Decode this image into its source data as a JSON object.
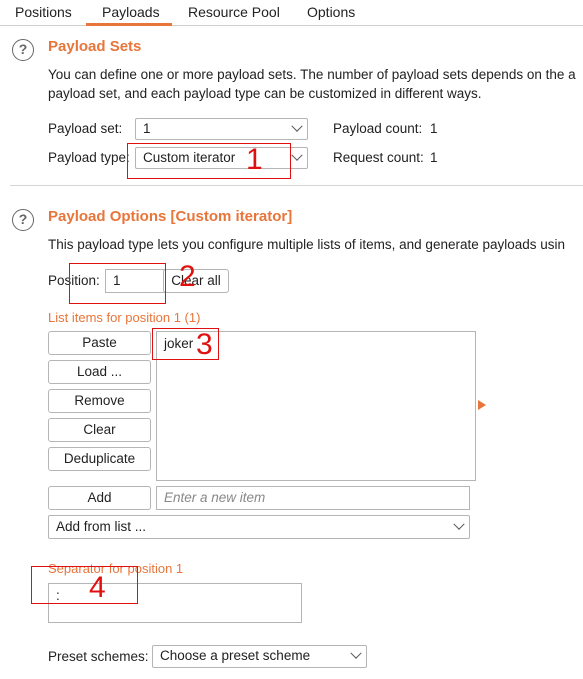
{
  "tabs": [
    {
      "label": "Positions"
    },
    {
      "label": "Payloads"
    },
    {
      "label": "Resource Pool"
    },
    {
      "label": "Options"
    }
  ],
  "payload_sets": {
    "title": "Payload Sets",
    "description_line1": "You can define one or more payload sets. The number of payload sets depends on the a",
    "description_line2": "payload set, and each payload type can be customized in different ways.",
    "set_label": "Payload set:",
    "set_value": "1",
    "count_label": "Payload count:",
    "count_value": "1",
    "type_label": "Payload type:",
    "type_value": "Custom iterator",
    "request_label": "Request count:",
    "request_value": "1"
  },
  "payload_options": {
    "title": "Payload Options [Custom iterator]",
    "description": "This payload type lets you configure multiple lists of items, and generate payloads usin",
    "position_label": "Position:",
    "position_value": "1",
    "clear_all_label": "Clear all",
    "list_items_label": "List items for position 1 (1)",
    "buttons": {
      "paste": "Paste",
      "load": "Load ...",
      "remove": "Remove",
      "clear": "Clear",
      "deduplicate": "Deduplicate",
      "add": "Add"
    },
    "list_items": [
      "joker"
    ],
    "new_item_placeholder": "Enter a new item",
    "add_from_list": "Add from list ...",
    "separator_label": "Separator for position 1",
    "separator_value": ":",
    "preset_label": "Preset schemes:",
    "preset_value": "Choose a preset scheme"
  },
  "annotations": [
    "1",
    "2",
    "3",
    "4"
  ],
  "colors": {
    "accent": "#e8753a",
    "annotation": "#e01010"
  }
}
